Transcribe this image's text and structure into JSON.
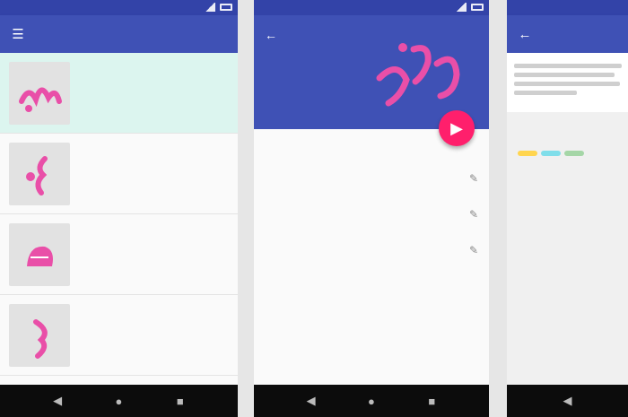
{
  "colors": {
    "primary": "#3f51b5",
    "primary_dark": "#3343a8",
    "accent": "#ff1f6c",
    "pink": "#e94fa8",
    "selected_row": "#dcf5ef"
  },
  "icons": {
    "menu": "menu-icon",
    "back": "arrow-back-icon",
    "fab": "play-icon",
    "step_arrow": "pencil-icon",
    "nav": [
      "back-nav-icon",
      "home-nav-icon",
      "recents-nav-icon"
    ]
  },
  "screen1": {
    "title": "",
    "items": [
      {
        "num": "",
        "name": "",
        "desc": "",
        "selected": true
      },
      {
        "num": "",
        "name": "",
        "desc": "",
        "selected": false
      },
      {
        "num": "",
        "name": "",
        "desc": "",
        "selected": false
      },
      {
        "num": "",
        "name": "",
        "desc": "",
        "selected": false
      }
    ]
  },
  "screen2": {
    "title": "",
    "section_label": "",
    "steps": [
      {
        "num": "",
        "text": ""
      },
      {
        "num": "",
        "text": ""
      },
      {
        "num": "",
        "text": ""
      },
      {
        "num": "",
        "text": ""
      },
      {
        "num": "",
        "text": ""
      },
      {
        "num": "",
        "text": ""
      }
    ]
  },
  "screen3": {
    "title": ""
  }
}
